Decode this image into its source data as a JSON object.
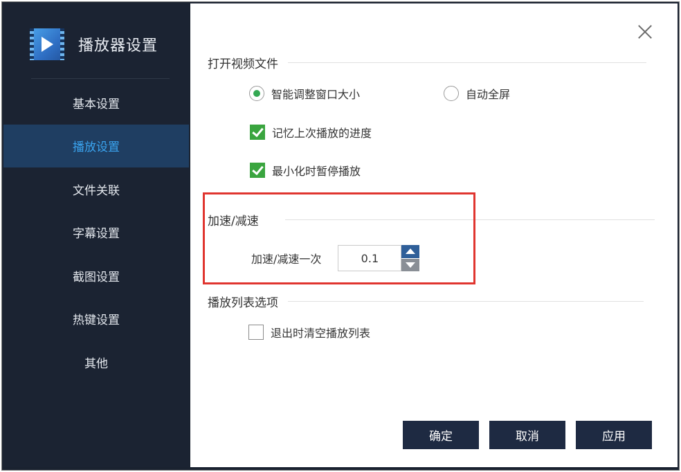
{
  "sidebar": {
    "title": "播放器设置",
    "logo_icon": "video-player-logo-icon",
    "items": [
      {
        "label": "基本设置",
        "active": false
      },
      {
        "label": "播放设置",
        "active": true
      },
      {
        "label": "文件关联",
        "active": false
      },
      {
        "label": "字幕设置",
        "active": false
      },
      {
        "label": "截图设置",
        "active": false
      },
      {
        "label": "热键设置",
        "active": false
      },
      {
        "label": "其他",
        "active": false
      }
    ],
    "active_color": "#3aa4f0"
  },
  "content": {
    "close_icon": "close-icon",
    "open_video": {
      "title": "打开视频文件",
      "radio_smart_resize": {
        "label": "智能调整窗口大小",
        "checked": true
      },
      "radio_fullscreen": {
        "label": "自动全屏",
        "checked": false
      },
      "check_remember_progress": {
        "label": "记忆上次播放的进度",
        "checked": true
      },
      "check_pause_minimize": {
        "label": "最小化时暂停播放",
        "checked": true
      }
    },
    "speed": {
      "title": "加速/减速",
      "step_label": "加速/减速一次",
      "step_value": "0.1"
    },
    "playlist": {
      "title": "播放列表选项",
      "check_clear_on_exit": {
        "label": "退出时清空播放列表",
        "checked": false
      }
    },
    "buttons": {
      "ok": "确定",
      "cancel": "取消",
      "apply": "应用"
    },
    "highlight_color": "#e0352f"
  }
}
